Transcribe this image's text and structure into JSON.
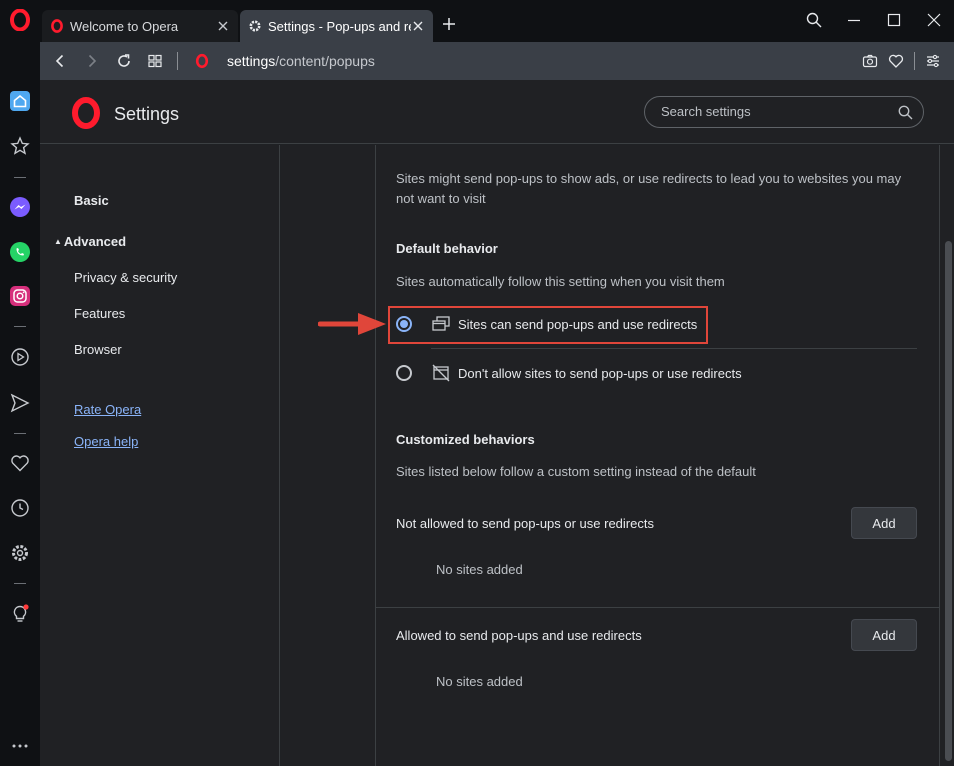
{
  "tabs": [
    {
      "title": "Welcome to Opera"
    },
    {
      "title": "Settings - Pop-ups and redirects"
    }
  ],
  "address": {
    "url_main": "settings",
    "url_rest": "/content/popups"
  },
  "header": {
    "title": "Settings",
    "search_placeholder": "Search settings"
  },
  "nav": {
    "basic": "Basic",
    "advanced": "Advanced",
    "privacy": "Privacy & security",
    "features": "Features",
    "browser": "Browser",
    "rate": "Rate Opera",
    "help": "Opera help"
  },
  "content": {
    "intro": "Sites might send pop-ups to show ads, or use redirects to lead you to websites you may not want to visit",
    "default_heading": "Default behavior",
    "default_desc": "Sites automatically follow this setting when you visit them",
    "option_allow": "Sites can send pop-ups and use redirects",
    "option_block": "Don't allow sites to send pop-ups or use redirects",
    "selected_option": "option_allow",
    "custom_heading": "Customized behaviors",
    "custom_desc": "Sites listed below follow a custom setting instead of the default",
    "not_allowed_label": "Not allowed to send pop-ups or use redirects",
    "not_allowed_empty": "No sites added",
    "allowed_label": "Allowed to send pop-ups and use redirects",
    "allowed_empty": "No sites added",
    "add_label": "Add"
  },
  "colors": {
    "opera_red": "#ff1b2d",
    "accent": "#8ab4f8",
    "highlight": "#e0463a"
  }
}
